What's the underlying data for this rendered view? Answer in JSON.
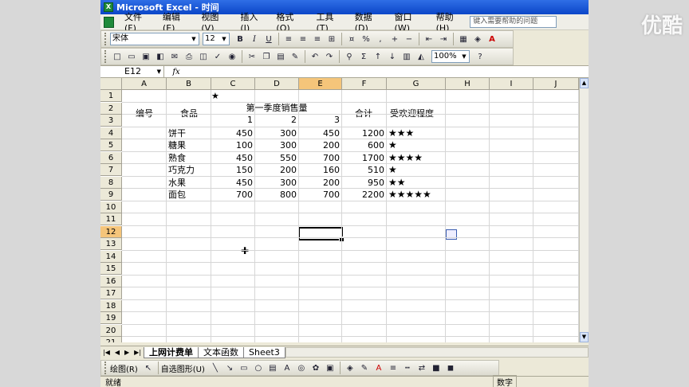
{
  "title": "Microsoft Excel - 时间",
  "menu": [
    "文件(F)",
    "编辑(E)",
    "视图(V)",
    "插入(I)",
    "格式(O)",
    "工具(T)",
    "数据(D)",
    "窗口(W)",
    "帮助(H)"
  ],
  "help_placeholder": "键入需要帮助的问题",
  "font_name": "宋体",
  "font_size": "12",
  "zoom": "100%",
  "name_box": "E12",
  "fx_label": "fx",
  "columns": [
    "A",
    "B",
    "C",
    "D",
    "E",
    "F",
    "G",
    "H",
    "I",
    "J"
  ],
  "rows": [
    "1",
    "2",
    "3",
    "4",
    "5",
    "6",
    "7",
    "8",
    "9",
    "10",
    "11",
    "12",
    "13",
    "14",
    "15",
    "16",
    "17",
    "18",
    "19",
    "20",
    "21"
  ],
  "cells": {
    "c1": "★",
    "a2": "编号",
    "b2": "食品",
    "c2": "第一季度销售量",
    "f2": "合计",
    "g2": "受欢迎程度",
    "c3": "1",
    "d3": "2",
    "e3": "3"
  },
  "data_rows": [
    {
      "food": "饼干",
      "q1": "450",
      "q2": "300",
      "q3": "450",
      "total": "1200",
      "stars": "★★★"
    },
    {
      "food": "糖果",
      "q1": "100",
      "q2": "300",
      "q3": "200",
      "total": "600",
      "stars": "★"
    },
    {
      "food": "熟食",
      "q1": "450",
      "q2": "550",
      "q3": "700",
      "total": "1700",
      "stars": "★★★★"
    },
    {
      "food": "巧克力",
      "q1": "150",
      "q2": "200",
      "q3": "160",
      "total": "510",
      "stars": "★"
    },
    {
      "food": "水果",
      "q1": "450",
      "q2": "300",
      "q3": "200",
      "total": "950",
      "stars": "★★"
    },
    {
      "food": "面包",
      "q1": "700",
      "q2": "800",
      "q3": "700",
      "total": "2200",
      "stars": "★★★★★"
    }
  ],
  "sheets": [
    "上网计费单",
    "文本函数",
    "Sheet3"
  ],
  "draw_label": "绘图(R)",
  "autoshape_label": "自选图形(U)",
  "status_ready": "就绪",
  "status_mode": "数字",
  "watermark": "优酷"
}
